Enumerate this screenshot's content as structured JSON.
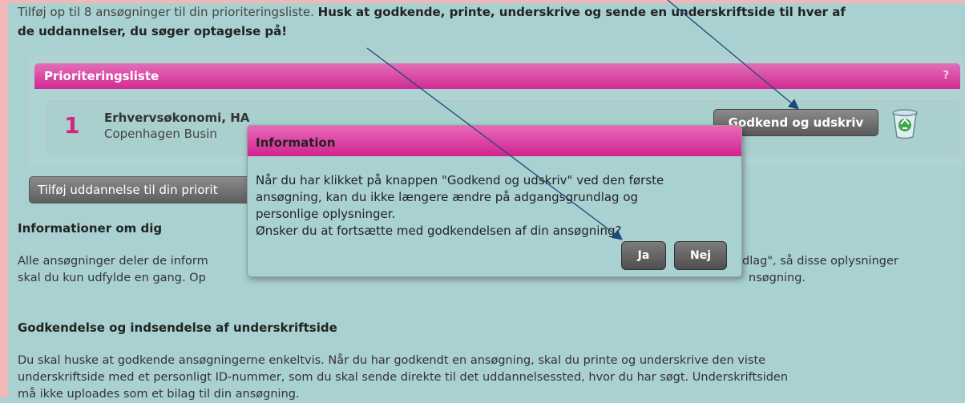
{
  "intro": {
    "line1_plain": "Tilføj op til 8 ansøgninger til din prioriteringsliste. ",
    "line1_bold": "Husk at godkende, printe, underskrive og sende en underskriftside til hver af",
    "line2_bold": "de uddannelser, du søger optagelse på!"
  },
  "priority_list": {
    "header": "Prioriteringsliste",
    "help": "?",
    "items": [
      {
        "number": "1",
        "title": "Erhvervsøkonomi, HA",
        "institution": "Copenhagen Busin",
        "approve_label": "Godkend og udskriv",
        "trash_icon": "recycle-bin-icon"
      }
    ]
  },
  "add_button_label": "Tilføj uddannelse til din priorit",
  "info_section": {
    "heading": "Informationer om dig",
    "line1_left": "Alle ansøgninger deler de inform",
    "line1_right": "dlag\", så disse oplysninger",
    "line2_left": "skal du kun udfylde en gang. Op",
    "line2_right": "nsøgning."
  },
  "sign_section": {
    "heading": "Godkendelse og indsendelse af underskriftside",
    "lines": [
      "Du skal huske at godkende ansøgningerne enkeltvis. Når du har godkendt en ansøgning, skal du printe og underskrive den viste",
      "underskriftside med et personligt ID-nummer, som du skal sende direkte til det uddannelsessted, hvor du har søgt. Underskriftsiden",
      "må ikke uploades som et bilag til din ansøgning."
    ]
  },
  "dialog": {
    "title": "Information",
    "lines": [
      "Når du har klikket på knappen \"Godkend og udskriv\" ved den første",
      "ansøgning, kan du ikke længere ændre på adgangsgrundlag og",
      "personlige oplysninger.",
      "Ønsker du at fortsætte med godkendelsen af din ansøgning?"
    ],
    "yes_label": "Ja",
    "no_label": "Nej"
  },
  "colors": {
    "background": "#a9d1d1",
    "accent_pink": "#d1228f",
    "button_gray": "#5a5a5a",
    "number_pink": "#d4267d",
    "annotation_arrow": "#1a4a7a"
  }
}
